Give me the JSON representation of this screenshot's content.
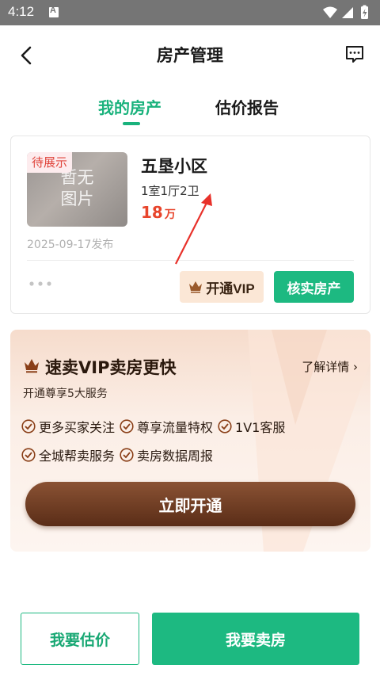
{
  "status_bar": {
    "time": "4:12"
  },
  "header": {
    "title": "房产管理"
  },
  "tabs": [
    {
      "label": "我的房产",
      "active": true
    },
    {
      "label": "估价报告",
      "active": false
    }
  ],
  "property": {
    "status_tag": "待展示",
    "thumb_placeholder_line1": "暂无",
    "thumb_placeholder_line2": "图片",
    "name": "五垦小区",
    "layout": "1室1厅2卫",
    "price": "18",
    "price_unit": "万",
    "published": "2025-09-17发布",
    "vip_button": "开通VIP",
    "verify_button": "核实房产"
  },
  "promo": {
    "title": "速卖VIP卖房更快",
    "detail_link": "了解详情",
    "subtitle": "开通尊享5大服务",
    "benefits": [
      "更多买家关注",
      "尊享流量特权",
      "1V1客服",
      "全城帮卖服务",
      "卖房数据周报"
    ],
    "cta": "立即开通"
  },
  "bottom": {
    "estimate_button": "我要估价",
    "sell_button": "我要卖房"
  },
  "colors": {
    "brand_green": "#1db981",
    "price_red": "#e8452c",
    "vip_brown": "#5a2d17"
  }
}
